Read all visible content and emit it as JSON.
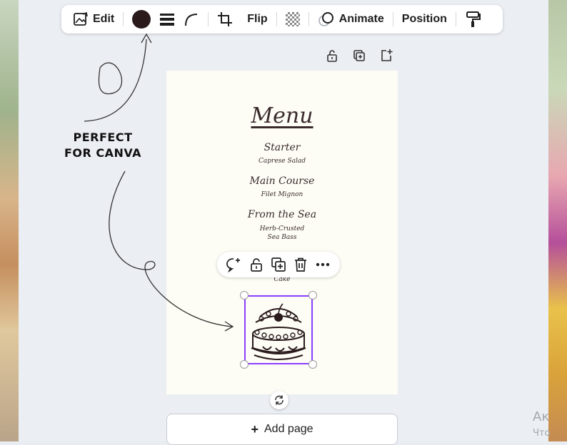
{
  "toolbar": {
    "edit_label": "Edit",
    "flip_label": "Flip",
    "animate_label": "Animate",
    "position_label": "Position",
    "color_value": "#2a1a1c"
  },
  "page": {
    "menu_title": "Menu",
    "items": [
      {
        "heading": "Starter",
        "detail": "Caprese Salad"
      },
      {
        "heading": "Main Course",
        "detail": "Filet Mignon"
      },
      {
        "heading": "From the Sea",
        "detail": "Herb-Crusted",
        "detail2": "Sea Bass"
      }
    ],
    "dessert_detail": "Cake"
  },
  "annotation": {
    "line1": "PERFECT",
    "line2": "FOR CANVA"
  },
  "add_page": {
    "label": "Add page"
  },
  "background_text": {
    "line1": "Ак",
    "line2": "Что"
  },
  "colors": {
    "selection": "#8b3dff",
    "menu_ink": "#3a2a2c",
    "page_bg": "#fdfdf6"
  }
}
